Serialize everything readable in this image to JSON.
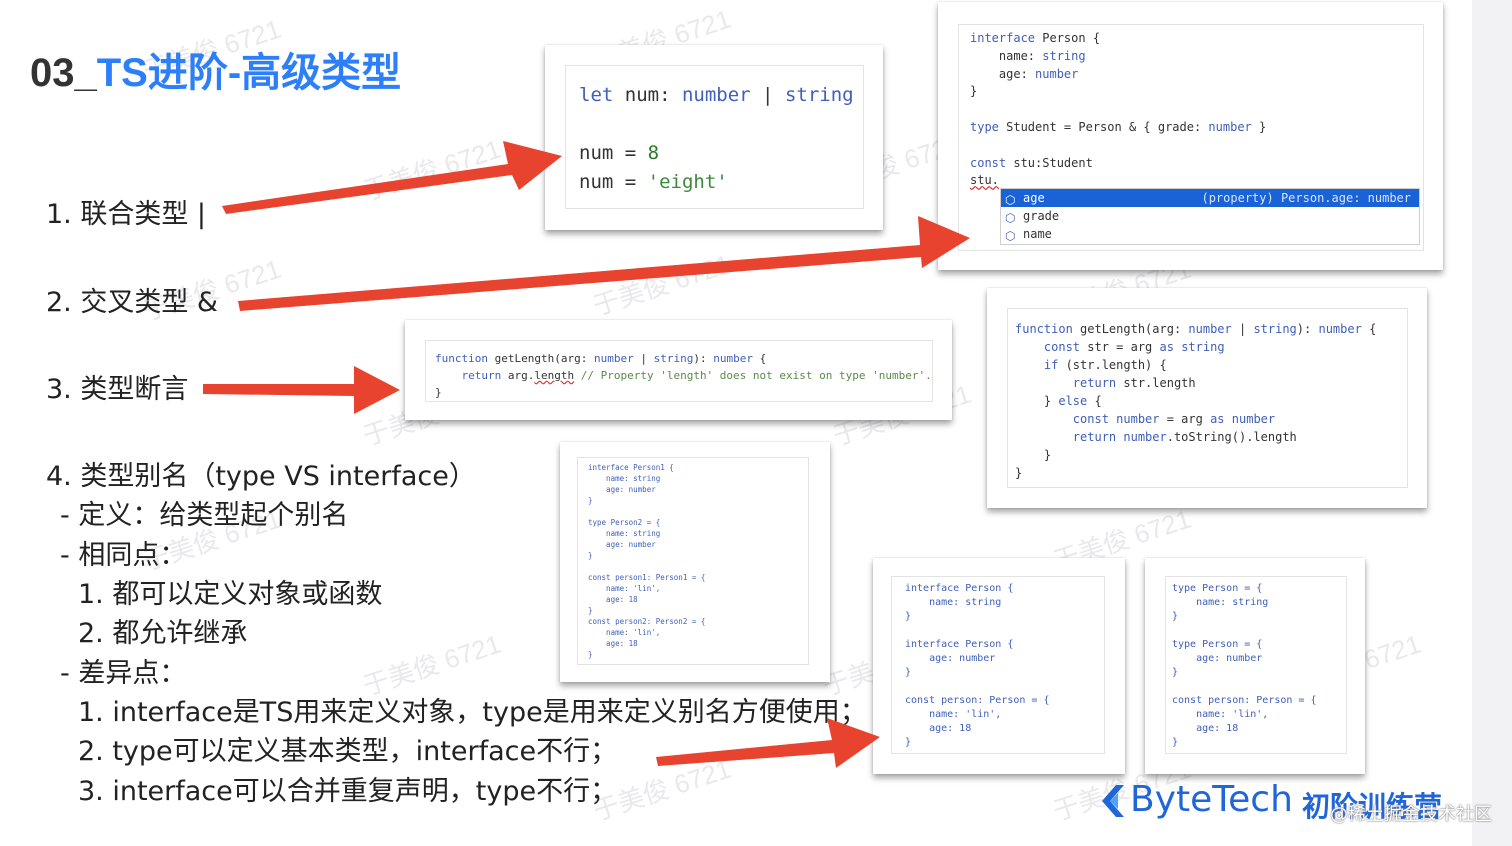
{
  "slide": {
    "title_prefix": "03_",
    "title_main": "TS进阶-高级类型"
  },
  "left_items": {
    "item1": "1. 联合类型  |",
    "item2": "2. 交叉类型 &",
    "item3": "3. 类型断言",
    "item4": "4. 类型别名（type VS interface）",
    "def": "- 定义：给类型起个别名",
    "same": "- 相同点：",
    "same1": "1. 都可以定义对象或函数",
    "same2": "2. 都允许继承",
    "diff": "- 差异点：",
    "diff1": "1. interface是TS用来定义对象，type是用来定义别名方便使用；",
    "diff2": "2. type可以定义基本类型，interface不行；",
    "diff3": "3. interface可以合并重复声明，type不行；"
  },
  "code_union": {
    "l1a": "let",
    "l1b": " num: ",
    "l1c": "number",
    "l1d": " | ",
    "l1e": "string",
    "l2a": "num = ",
    "l2b": "8",
    "l3a": "num = ",
    "l3b": "'eight'"
  },
  "code_intersect": {
    "a1": "interface",
    "a2": " Person {",
    "b1": "    name: ",
    "b2": "string",
    "c1": "    age: ",
    "c2": "number",
    "d": "}",
    "e1": "type",
    "e2": " Student = Person & { grade: ",
    "e3": "number",
    "e4": " }",
    "f1": "const",
    "f2": " stu:Student",
    "g": "stu.",
    "ac": {
      "item1": "age",
      "item1_detail": "(property) Person.age: number",
      "item2": "grade",
      "item3": "name",
      "icon": "⬡"
    }
  },
  "code_assert_err": {
    "a1": "function",
    "a2": " getLength(arg: ",
    "a3": "number",
    "a4": " | ",
    "a5": "string",
    "a6": "): ",
    "a7": "number",
    "a8": " {",
    "b1": "    return",
    "b2": " arg.",
    "b3": "length",
    "b4": " // Property 'length' does not exist on type 'number'.",
    "c": "}"
  },
  "code_assert_ok": {
    "l1a": "function",
    "l1b": " getLength(arg: ",
    "l1c": "number",
    "l1d": " | ",
    "l1e": "string",
    "l1f": "): ",
    "l1g": "number",
    "l1h": " {",
    "l2a": "    const",
    "l2b": " str = arg ",
    "l2c": "as",
    "l2d": " ",
    "l2e": "string",
    "l3a": "    if",
    "l3b": " (str.length) {",
    "l4a": "        return",
    "l4b": " str.length",
    "l5a": "    } ",
    "l5b": "else",
    "l5c": " {",
    "l6a": "        const",
    "l6b": " number",
    "l6c": " = arg ",
    "l6d": "as",
    "l6e": " ",
    "l6f": "number",
    "l7a": "        return",
    "l7b": " number",
    "l7c": ".toString().length",
    "l8": "    }",
    "l9": "}"
  },
  "code_alias": {
    "text": "interface Person1 {\n    name: string\n    age: number\n}\n\ntype Person2 = {\n    name: string\n    age: number\n}\n\nconst person1: Person1 = {\n    name: 'lin',\n    age: 18\n}\nconst person2: Person2 = {\n    name: 'lin',\n    age: 18\n}"
  },
  "code_merge_iface": {
    "text": "interface Person {\n    name: string\n}\n\ninterface Person {\n    age: number\n}\n\nconst person: Person = {\n    name: 'lin',\n    age: 18\n}"
  },
  "code_merge_type": {
    "text": "type Person = {\n    name: string\n}\n\ntype Person = {\n    age: number\n}\n\nconst person: Person = {\n    name: 'lin',\n    age: 18\n}"
  },
  "watermark": {
    "text": "于美俊 6721"
  },
  "brand": {
    "name": "ByteTech",
    "sub": "初阶训练营",
    "site": "@稀土掘金技术社区"
  },
  "colors": {
    "title_accent": "#2d7ff9",
    "arrow": "#e8432e",
    "brand": "#1f66d9"
  }
}
